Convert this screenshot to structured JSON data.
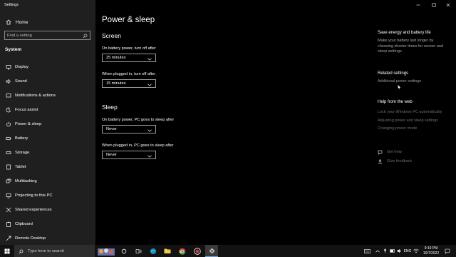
{
  "window": {
    "title": "Settings"
  },
  "sidebar": {
    "home_label": "Home",
    "search_placeholder": "Find a setting",
    "section": "System",
    "items": [
      {
        "label": "Display",
        "icon": "display-icon"
      },
      {
        "label": "Sound",
        "icon": "sound-icon"
      },
      {
        "label": "Notifications & actions",
        "icon": "notifications-icon"
      },
      {
        "label": "Focus assist",
        "icon": "focus-assist-icon"
      },
      {
        "label": "Power & sleep",
        "icon": "power-icon"
      },
      {
        "label": "Battery",
        "icon": "battery-icon"
      },
      {
        "label": "Storage",
        "icon": "storage-icon"
      },
      {
        "label": "Tablet",
        "icon": "tablet-icon"
      },
      {
        "label": "Multitasking",
        "icon": "multitasking-icon"
      },
      {
        "label": "Projecting to this PC",
        "icon": "projecting-icon"
      },
      {
        "label": "Shared experiences",
        "icon": "shared-experiences-icon"
      },
      {
        "label": "Clipboard",
        "icon": "clipboard-icon"
      },
      {
        "label": "Remote Desktop",
        "icon": "remote-desktop-icon"
      }
    ]
  },
  "main": {
    "title": "Power & sleep",
    "screen": {
      "heading": "Screen",
      "battery_label": "On battery power, turn off after",
      "battery_value": "25 minutes",
      "plugged_label": "When plugged in, turn off after",
      "plugged_value": "15 minutes"
    },
    "sleep": {
      "heading": "Sleep",
      "battery_label": "On battery power, PC goes to sleep after",
      "battery_value": "Never",
      "plugged_label": "When plugged in, PC goes to sleep after",
      "plugged_value": "Never"
    }
  },
  "right": {
    "energy_heading": "Save energy and battery life",
    "energy_text": "Make your battery last longer by choosing shorter times for screen and sleep settings.",
    "related_heading": "Related settings",
    "related_link": "Additional power settings",
    "help_heading": "Help from the web",
    "help_links": [
      "Lock your Windows PC automatically",
      "Adjusting power and sleep settings",
      "Changing power mode"
    ],
    "get_help": "Get help",
    "give_feedback": "Give feedback"
  },
  "taskbar": {
    "search_placeholder": "Type here to search",
    "language": "ENG",
    "time": "9:19 PM",
    "date": "10/7/2022"
  },
  "colors": {
    "sidebar_bg": "#1f1f1f",
    "main_bg": "#000000",
    "taskbar_bg": "#121212"
  }
}
